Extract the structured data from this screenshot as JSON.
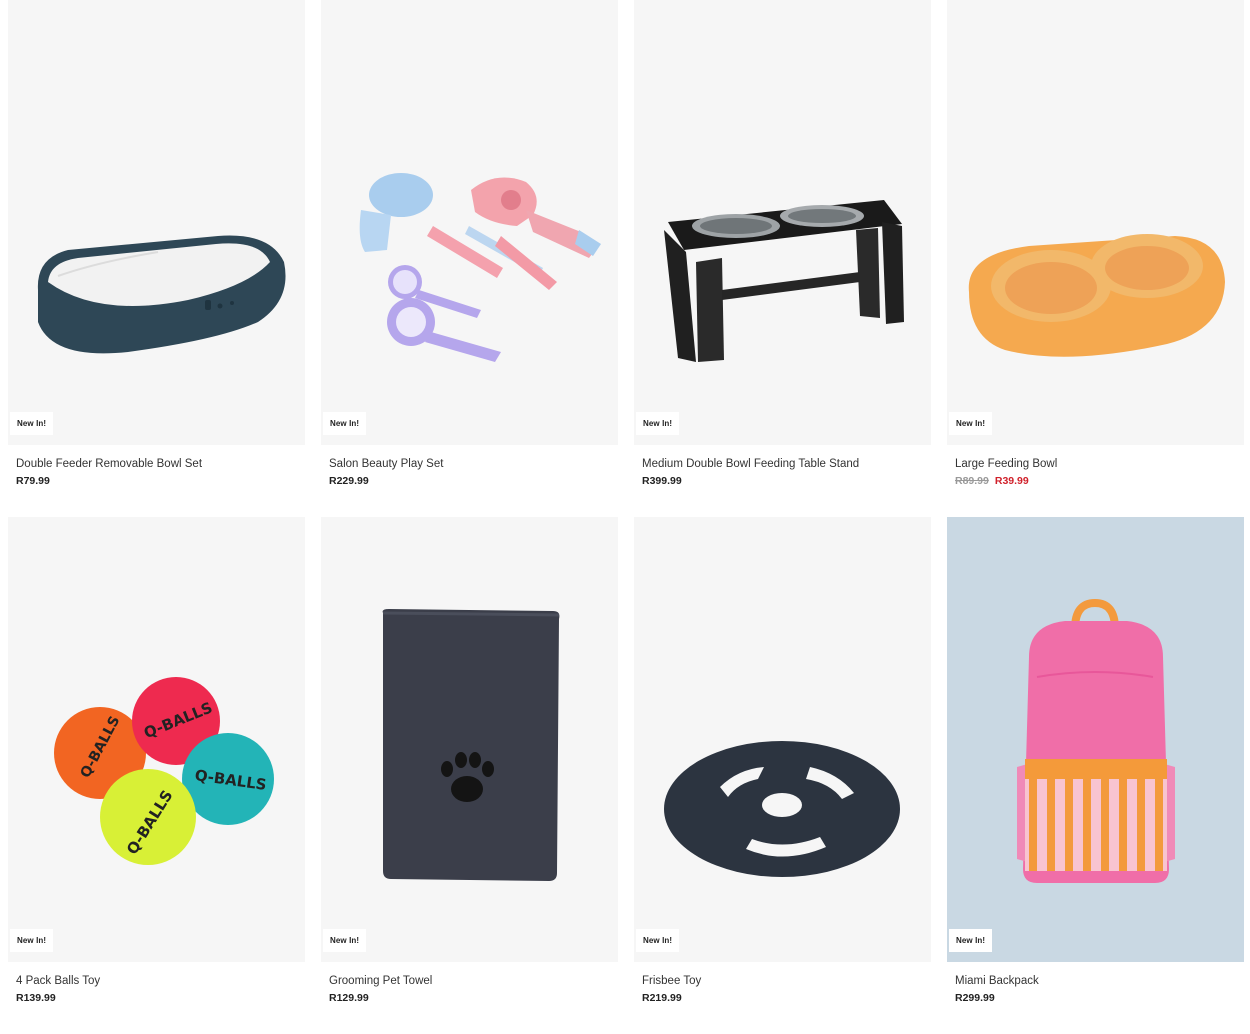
{
  "products": [
    {
      "name": "Double Feeder Removable Bowl Set",
      "badge": "New In!",
      "price": "R79.99"
    },
    {
      "name": "Salon Beauty Play Set",
      "badge": "New In!",
      "price": "R229.99"
    },
    {
      "name": "Medium Double Bowl Feeding Table Stand",
      "badge": "New In!",
      "price": "R399.99"
    },
    {
      "name": "Large Feeding Bowl",
      "badge": "New In!",
      "was_price": "R89.99",
      "price": "R39.99"
    },
    {
      "name": "4 Pack Balls Toy",
      "badge": "New In!",
      "price": "R139.99"
    },
    {
      "name": "Grooming Pet Towel",
      "badge": "New In!",
      "price": "R129.99"
    },
    {
      "name": "Frisbee Toy",
      "badge": "New In!",
      "price": "R219.99"
    },
    {
      "name": "Miami Backpack",
      "badge": "New In!",
      "price": "R299.99"
    }
  ],
  "ball_text": "Q-BALLS",
  "colors": {
    "sale": "#d0202a",
    "image_bg": "#f6f6f6"
  }
}
